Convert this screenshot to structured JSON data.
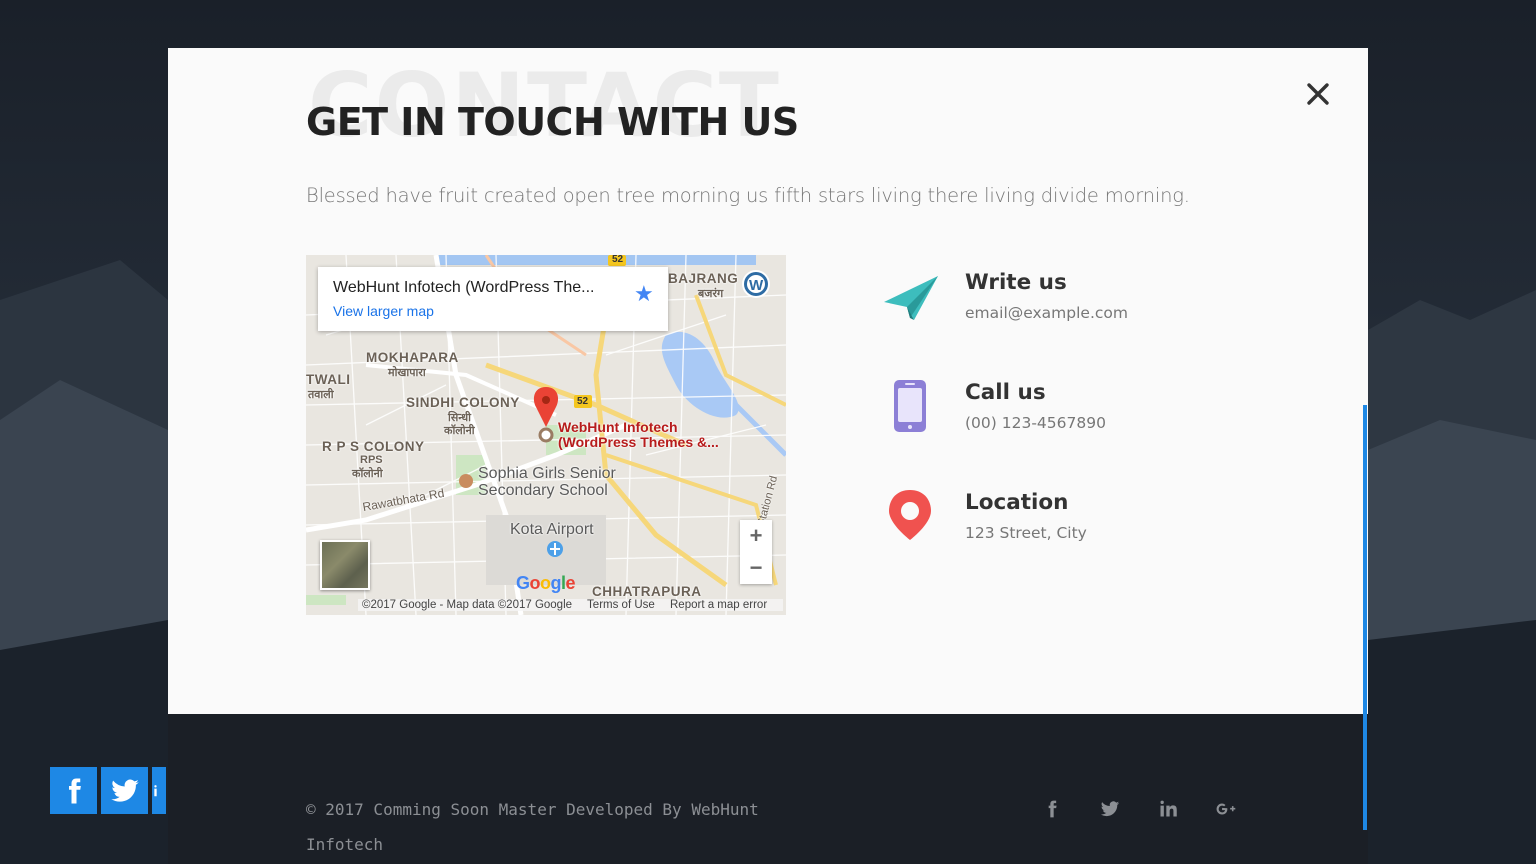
{
  "modal": {
    "ghost_heading": "CONTACT",
    "title": "GET IN TOUCH WITH US",
    "subtitle": "Blessed have fruit created open tree morning us fifth stars living there living divide morning.",
    "close_label": "×"
  },
  "map": {
    "place_name": "WebHunt Infotech (WordPress The...",
    "view_larger": "View larger map",
    "pin_label_line1": "WebHunt Infotech",
    "pin_label_line2": "(WordPress Themes &...",
    "places": {
      "mokhapara": "MOKHAPARA",
      "mokhapara_hi": "मोखापारा",
      "twali": "TWALI",
      "twali_hi": "तवाली",
      "sindhi": "SINDHI COLONY",
      "sindhi_hi1": "सिन्धी",
      "sindhi_hi2": "कॉलोनी",
      "rps": "R P S COLONY",
      "rps2": "RPS",
      "rps_hi": "कॉलोनी",
      "bajrang": "BAJRANG",
      "bajrang_hi": "बजरंग",
      "chhatrapura": "CHHATRAPURA",
      "rawatbhata": "Rawatbhata Rd",
      "station": "Station Rd"
    },
    "poi_school_1": "Sophia Girls Senior",
    "poi_school_2": "Secondary School",
    "poi_airport": "Kota Airport",
    "highway": "52",
    "zoom_in": "+",
    "zoom_out": "−",
    "google": "Google",
    "footer_data": "©2017 Google - Map data ©2017 Google",
    "footer_terms": "Terms of Use",
    "footer_report": "Report a map error"
  },
  "contact": [
    {
      "icon": "paper-plane-icon",
      "label": "Write us",
      "value": "email@example.com"
    },
    {
      "icon": "phone-icon",
      "label": "Call us",
      "value": "(00) 123-4567890"
    },
    {
      "icon": "location-pin-icon",
      "label": "Location",
      "value": "123 Street, City"
    }
  ],
  "footer": {
    "copyright": "© 2017 Comming Soon Master Developed By WebHunt Infotech",
    "social": [
      "facebook",
      "twitter",
      "linkedin",
      "google-plus"
    ]
  },
  "colors": {
    "accent": "#1e88e5",
    "plane": "#3dbdbd",
    "phone": "#8c7fd6",
    "pin": "#f0524f",
    "footer_bg": "#1b1f26"
  }
}
